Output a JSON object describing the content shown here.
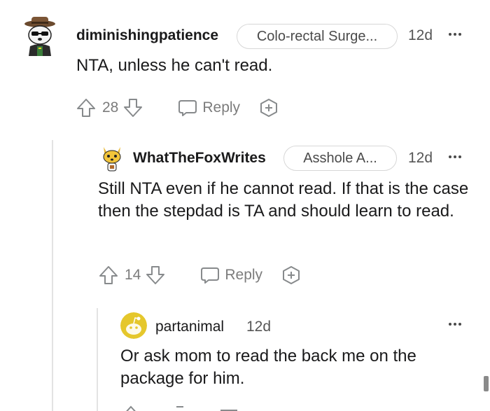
{
  "comments": [
    {
      "username": "diminishingpatience",
      "flair": "Colo-rectal Surge...",
      "time": "12d",
      "body": "NTA, unless he can't read.",
      "votes": "28",
      "reply_label": "Reply"
    },
    {
      "username": "WhatTheFoxWrites",
      "flair": "Asshole A...",
      "time": "12d",
      "body": "Still NTA even if he cannot read. If that is the case then the stepdad is TA and should learn to read.",
      "votes": "14",
      "reply_label": "Reply"
    },
    {
      "username": "partanimal",
      "time": "12d",
      "body": "Or ask mom to read the back me on the package for him."
    }
  ],
  "icons": {
    "upvote": "arrow-up-icon",
    "downvote": "arrow-down-icon",
    "reply": "speech-bubble-icon",
    "award": "award-plus-icon",
    "more": "more-dots-icon"
  },
  "colors": {
    "text": "#1a1a1b",
    "muted": "#7c7c7c",
    "flair_border": "#d7d7d7",
    "thread_line": "#e3e3e3",
    "snoo_yellow": "#e5c72c"
  }
}
